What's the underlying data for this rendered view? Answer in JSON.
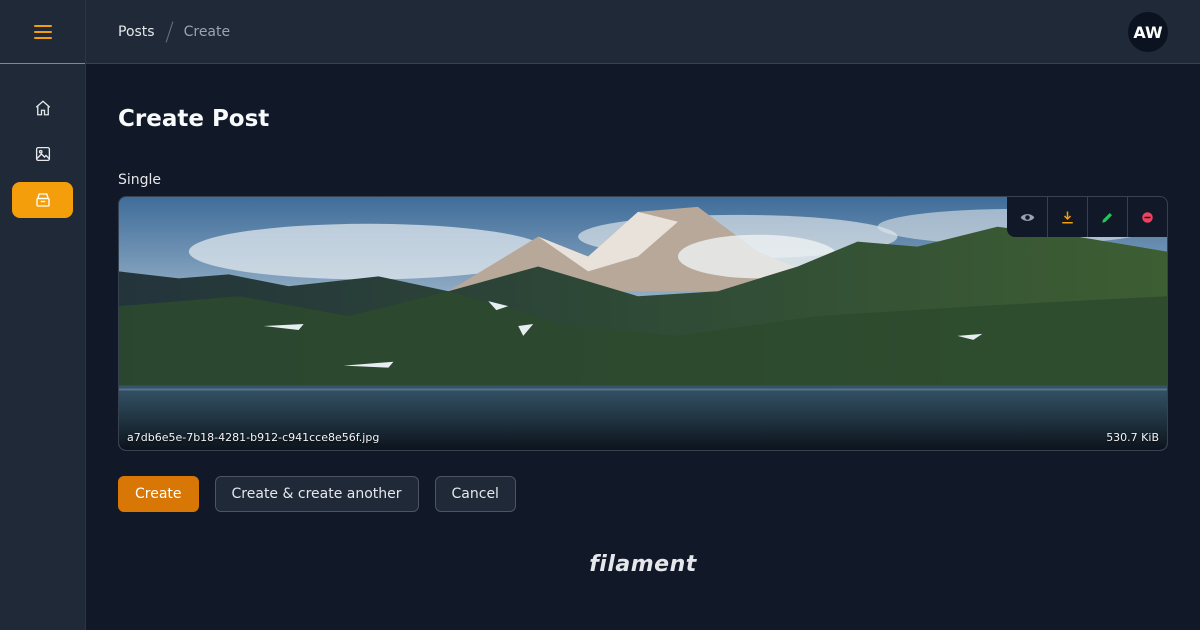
{
  "breadcrumbs": [
    "Posts",
    "Create"
  ],
  "user": {
    "initials": "AW"
  },
  "sidebar": {
    "items": [
      {
        "icon": "home-icon"
      },
      {
        "icon": "image-icon"
      },
      {
        "icon": "archive-box-icon",
        "active": true
      }
    ]
  },
  "page": {
    "title": "Create Post"
  },
  "upload": {
    "label": "Single",
    "file_name": "a7db6e5e-7b18-4281-b912-c941cce8e56f.jpg",
    "file_size": "530.7 KiB",
    "actions": [
      "eye-icon",
      "download-icon",
      "pencil-icon",
      "remove-icon"
    ]
  },
  "buttons": {
    "create": "Create",
    "create_another": "Create & create another",
    "cancel": "Cancel"
  },
  "footer": {
    "brand": "filament"
  },
  "colors": {
    "accent": "#f59e0b",
    "primary_button": "#d97706",
    "background": "#111827"
  }
}
